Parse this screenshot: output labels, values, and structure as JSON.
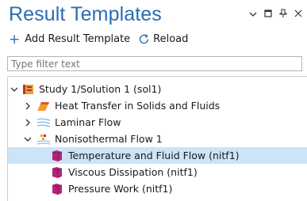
{
  "panel": {
    "title": "Result Templates"
  },
  "toolbar": {
    "add_label": "Add Result Template",
    "reload_label": "Reload"
  },
  "filter": {
    "placeholder": "Type filter text"
  },
  "tree": {
    "items": [
      {
        "label": "Study 1/Solution 1 (sol1)",
        "expanded": true,
        "icon": "study-icon"
      },
      {
        "label": "Heat Transfer in Solids and Fluids",
        "expanded": false,
        "icon": "heat-transfer-icon"
      },
      {
        "label": "Laminar Flow",
        "expanded": false,
        "icon": "laminar-flow-icon"
      },
      {
        "label": "Nonisothermal Flow 1",
        "expanded": true,
        "icon": "nonisothermal-flow-icon"
      },
      {
        "label": "Temperature and Fluid Flow (nitf1)",
        "selected": true,
        "icon": "template-icon"
      },
      {
        "label": "Viscous Dissipation (nitf1)",
        "icon": "template-icon"
      },
      {
        "label": "Pressure Work (nitf1)",
        "icon": "template-icon"
      }
    ]
  },
  "colors": {
    "title": "#2a6db5",
    "selection": "#cce4f7",
    "template_icon": "#b2247a"
  }
}
